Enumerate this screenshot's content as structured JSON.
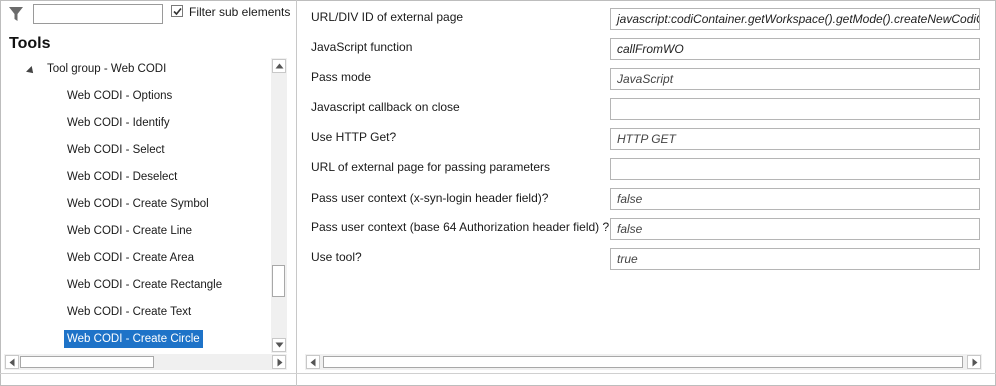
{
  "filter": {
    "search_value": "",
    "checkbox_checked": true,
    "checkbox_label": "Filter sub elements"
  },
  "tools": {
    "title": "Tools",
    "group": "Tool group - Web CODI",
    "items": [
      {
        "label": "Web CODI - Options"
      },
      {
        "label": "Web CODI - Identify"
      },
      {
        "label": "Web CODI - Select"
      },
      {
        "label": "Web CODI - Deselect"
      },
      {
        "label": "Web CODI - Create Symbol"
      },
      {
        "label": "Web CODI - Create Line"
      },
      {
        "label": "Web CODI - Create Area"
      },
      {
        "label": "Web CODI - Create Rectangle"
      },
      {
        "label": "Web CODI - Create Text"
      },
      {
        "label": "Web CODI - Create Circle"
      }
    ],
    "selected": "Web CODI - Create Circle"
  },
  "properties": [
    {
      "label": "URL/DIV ID of external page",
      "value": "javascript:codiContainer.getWorkspace().getMode().createNewCodiC"
    },
    {
      "label": "JavaScript function",
      "value": "callFromWO"
    },
    {
      "label": "Pass mode",
      "value": "JavaScript"
    },
    {
      "label": "Javascript callback on close",
      "value": ""
    },
    {
      "label": "Use HTTP Get?",
      "value": "HTTP GET"
    },
    {
      "label": "URL of external page for passing parameters",
      "value": ""
    },
    {
      "label": "Pass user context (x-syn-login header field)?",
      "value": "false"
    },
    {
      "label": "Pass user context (base 64 Authorization header field) ?",
      "value": "false"
    },
    {
      "label": "Use tool?",
      "value": "true"
    }
  ],
  "colors": {
    "selection": "#1e73c8",
    "border": "#b5b5b5"
  }
}
